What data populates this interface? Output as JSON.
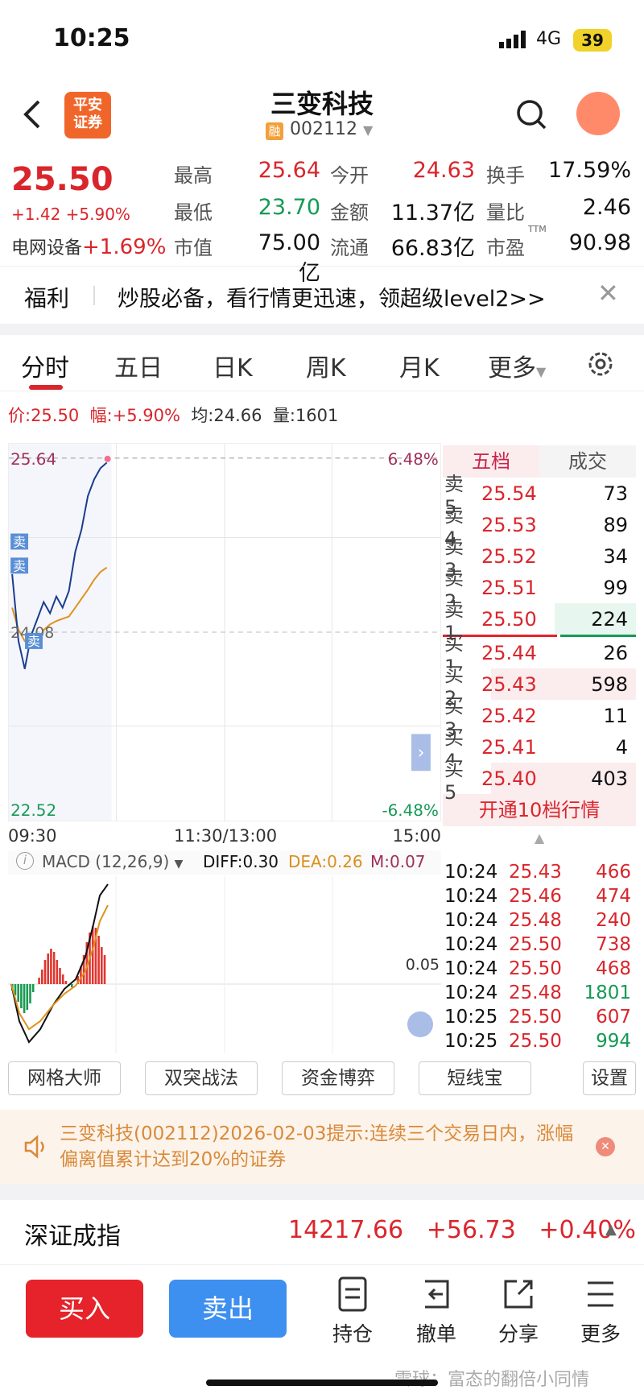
{
  "status_bar": {
    "time": "10:25",
    "network": "4G",
    "battery": "39"
  },
  "header": {
    "broker_logo": "平安\n证券",
    "stock_name": "三变科技",
    "margin_tag": "融",
    "stock_code": "002112"
  },
  "quote": {
    "price": "25.50",
    "change": "+1.42 +5.90%",
    "sector": "电网设备",
    "sector_change": "+1.69%",
    "fields": [
      {
        "label": "最高",
        "value": "25.64",
        "color": "red"
      },
      {
        "label": "今开",
        "value": "24.63",
        "color": "red"
      },
      {
        "label": "换手",
        "value": "17.59%",
        "color": "black"
      },
      {
        "label": "最低",
        "value": "23.70",
        "color": "green"
      },
      {
        "label": "金额",
        "value": "11.37亿",
        "color": "black"
      },
      {
        "label": "量比",
        "value": "2.46",
        "color": "black"
      },
      {
        "label": "市值",
        "value": "75.00亿",
        "color": "black"
      },
      {
        "label": "流通",
        "value": "66.83亿",
        "color": "black"
      },
      {
        "label": "市盈",
        "value": "90.98",
        "color": "black"
      }
    ],
    "pe_sup": "TTM"
  },
  "promo": {
    "tag": "福利",
    "text": "炒股必备，看行情更迅速，领超级level2>>"
  },
  "tabs": [
    "分时",
    "五日",
    "日K",
    "周K",
    "月K",
    "更多"
  ],
  "info_line": {
    "price": "价:25.50",
    "change": "幅:+5.90%",
    "avg": "均:24.66",
    "volume": "量:1601"
  },
  "chart": {
    "top_price": "25.64",
    "top_pct": "6.48%",
    "mid_price": "24.08",
    "bottom_price": "22.52",
    "bottom_pct": "-6.48%",
    "time_start": "09:30",
    "time_mid": "11:30/13:00",
    "time_end": "15:00",
    "sell_tag": "卖",
    "expand": "›"
  },
  "macd": {
    "name": "MACD (12,26,9)",
    "diff": "DIFF:0.30",
    "dea": "DEA:0.26",
    "m": "M:0.07",
    "level": "0.05"
  },
  "chart_data": {
    "type": "line",
    "title": "",
    "xlabel": "",
    "ylabel": "",
    "ylim": [
      22.52,
      25.64
    ],
    "x": [
      "09:30",
      "09:31",
      "09:33",
      "09:35",
      "09:37",
      "09:39",
      "09:41",
      "09:43",
      "09:45",
      "09:47",
      "09:49",
      "09:51",
      "09:53",
      "09:55",
      "09:57",
      "09:59"
    ],
    "series": [
      {
        "name": "价",
        "values": [
          24.6,
          24.0,
          23.75,
          24.05,
          24.2,
          24.35,
          24.25,
          24.4,
          24.3,
          24.45,
          24.8,
          25.0,
          25.3,
          25.45,
          25.55,
          25.6
        ]
      },
      {
        "name": "均",
        "values": [
          24.3,
          24.1,
          24.0,
          23.98,
          24.0,
          24.1,
          24.15,
          24.18,
          24.2,
          24.22,
          24.3,
          24.38,
          24.46,
          24.55,
          24.62,
          24.66
        ]
      }
    ]
  },
  "order_book": {
    "tab_active": "五档",
    "tab_other": "成交",
    "sells": [
      {
        "label": "卖5",
        "price": "25.54",
        "vol": "73"
      },
      {
        "label": "卖4",
        "price": "25.53",
        "vol": "89"
      },
      {
        "label": "卖3",
        "price": "25.52",
        "vol": "34"
      },
      {
        "label": "卖2",
        "price": "25.51",
        "vol": "99"
      },
      {
        "label": "卖1",
        "price": "25.50",
        "vol": "224"
      }
    ],
    "buys": [
      {
        "label": "买1",
        "price": "25.44",
        "vol": "26"
      },
      {
        "label": "买2",
        "price": "25.43",
        "vol": "598"
      },
      {
        "label": "买3",
        "price": "25.42",
        "vol": "11"
      },
      {
        "label": "买4",
        "price": "25.41",
        "vol": "4"
      },
      {
        "label": "买5",
        "price": "25.40",
        "vol": "403"
      }
    ],
    "upgrade": "开通10档行情"
  },
  "trades": [
    {
      "time": "10:24",
      "price": "25.43",
      "vol": "466",
      "color": "red"
    },
    {
      "time": "10:24",
      "price": "25.46",
      "vol": "474",
      "color": "red"
    },
    {
      "time": "10:24",
      "price": "25.48",
      "vol": "240",
      "color": "red"
    },
    {
      "time": "10:24",
      "price": "25.50",
      "vol": "738",
      "color": "red"
    },
    {
      "time": "10:24",
      "price": "25.50",
      "vol": "468",
      "color": "red"
    },
    {
      "time": "10:24",
      "price": "25.48",
      "vol": "1801",
      "color": "green"
    },
    {
      "time": "10:25",
      "price": "25.50",
      "vol": "607",
      "color": "red"
    },
    {
      "time": "10:25",
      "price": "25.50",
      "vol": "994",
      "color": "green"
    }
  ],
  "tools": [
    "网格大师",
    "双突战法",
    "资金博弈",
    "短线宝",
    "设置"
  ],
  "alert": {
    "text": "三变科技(002112)2026-02-03提示:连续三个交易日内，涨幅偏离值累计达到20%的证券"
  },
  "index_bar": {
    "name": "深证成指",
    "value": "14217.66",
    "change": "+56.73",
    "pct": "+0.40%"
  },
  "bottom": {
    "buy": "买入",
    "sell": "卖出",
    "actions": [
      "持仓",
      "撤单",
      "分享",
      "更多"
    ],
    "watermark": "雪球：富态的翻倍小同情"
  },
  "colors": {
    "up": "#d9262c",
    "down": "#159a55",
    "buy_button": "#e6222a",
    "sell_button": "#3d8ff0"
  }
}
